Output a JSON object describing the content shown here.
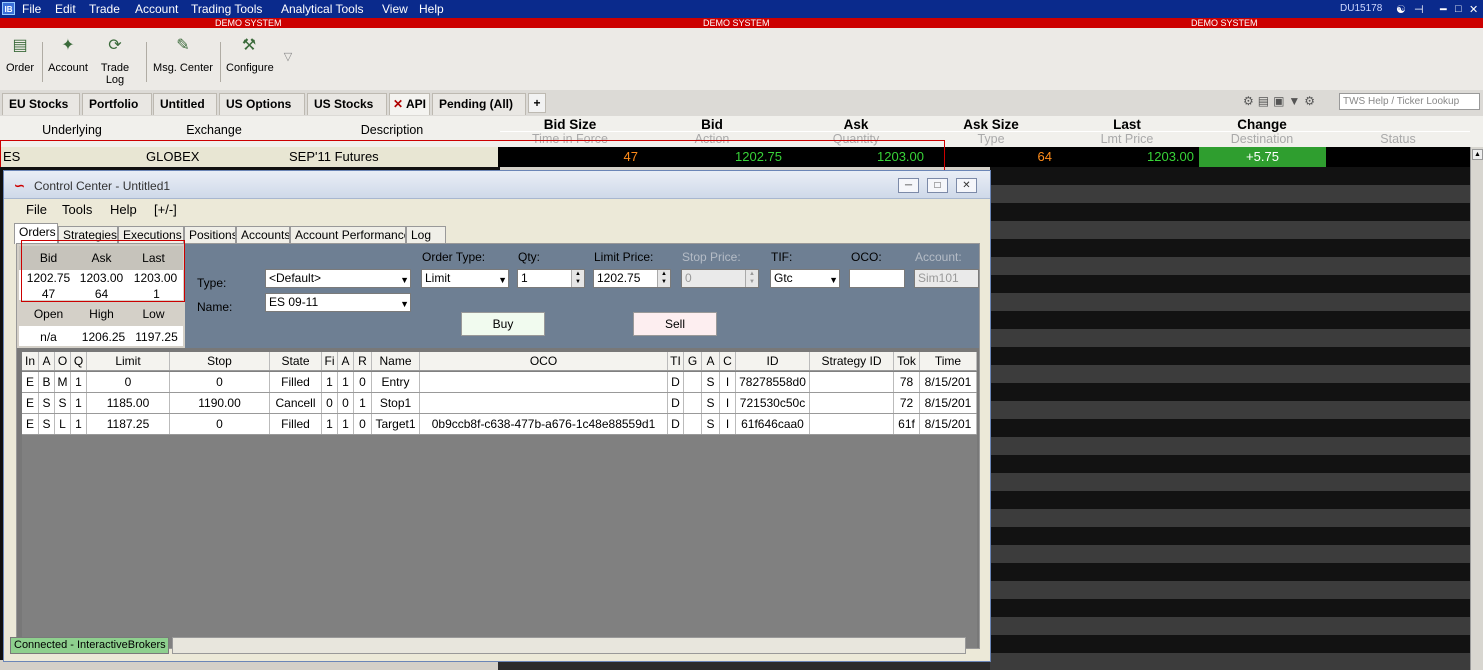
{
  "menubar": {
    "logo": "IB",
    "items": [
      "File",
      "Edit",
      "Trade",
      "Account",
      "Trading Tools",
      "Analytical Tools",
      "View",
      "Help"
    ],
    "account_id": "DU15178"
  },
  "demo_banner": [
    "DEMO SYSTEM",
    "DEMO SYSTEM",
    "DEMO SYSTEM"
  ],
  "toolbar": {
    "items": [
      "Order",
      "Account",
      "Trade Log",
      "Msg. Center",
      "Configure"
    ]
  },
  "tabs": {
    "items": [
      "EU Stocks",
      "Portfolio",
      "Untitled",
      "US Options",
      "US Stocks",
      "API",
      "Pending (All)"
    ],
    "active": "API",
    "add": "+",
    "search_placeholder": "TWS Help / Ticker Lookup"
  },
  "columns": {
    "left": [
      "Underlying",
      "Exchange",
      "Description"
    ],
    "top": [
      "Bid Size",
      "Bid",
      "Ask",
      "Ask Size",
      "Last",
      "Change"
    ],
    "sub": [
      "Time in Force",
      "Action",
      "Quantity",
      "Type",
      "Lmt Price",
      "Destination",
      "Status"
    ]
  },
  "row": {
    "underlying": "ES",
    "exchange": "GLOBEX",
    "description": "SEP'11 Futures",
    "bid_size": "47",
    "bid": "1202.75",
    "ask": "1203.00",
    "ask_size": "64",
    "last": "1203.00",
    "change": "+5.75"
  },
  "colors": {
    "bid_size": "#ff8c1a",
    "price": "#38d338",
    "change_bg": "#2f9e2f",
    "demo": "#cc0000",
    "menubar": "#0a2a8c"
  },
  "control_center": {
    "title": "Control Center - Untitled1",
    "menu": [
      "File",
      "Tools",
      "Help",
      "[+/-]"
    ],
    "tabs": [
      "Orders",
      "Strategies",
      "Executions",
      "Positions",
      "Accounts",
      "Account Performance",
      "Log"
    ],
    "active_tab": "Orders",
    "quote": {
      "headers": [
        "Bid",
        "Ask",
        "Last"
      ],
      "prices": [
        "1202.75",
        "1203.00",
        "1203.00"
      ],
      "sizes": [
        "47",
        "64",
        "1"
      ],
      "headers2": [
        "Open",
        "High",
        "Low"
      ],
      "values2": [
        "n/a",
        "1206.25",
        "1197.25"
      ]
    },
    "form": {
      "type_label": "Type:",
      "type_value": "<Default>",
      "name_label": "Name:",
      "name_value": "ES 09-11",
      "order_type_label": "Order Type:",
      "order_type_value": "Limit",
      "qty_label": "Qty:",
      "qty_value": "1",
      "limit_label": "Limit Price:",
      "limit_value": "1202.75",
      "stop_label": "Stop Price:",
      "stop_value": "0",
      "tif_label": "TIF:",
      "tif_value": "Gtc",
      "oco_label": "OCO:",
      "oco_value": "",
      "account_label": "Account:",
      "account_value": "Sim101",
      "buy": "Buy",
      "sell": "Sell"
    },
    "grid": {
      "headers": [
        "In",
        "A",
        "O",
        "Q",
        "Limit",
        "Stop",
        "State",
        "Fi",
        "A",
        "R",
        "Name",
        "OCO",
        "TI",
        "G",
        "A",
        "C",
        "ID",
        "Strategy ID",
        "Tok",
        "Time"
      ],
      "rows": [
        [
          "E",
          "B",
          "M",
          "1",
          "0",
          "0",
          "Filled",
          "1",
          "1",
          "0",
          "Entry",
          "",
          "D",
          "",
          "S",
          "I",
          "78278558d0",
          "",
          "78",
          "8/15/201"
        ],
        [
          "E",
          "S",
          "S",
          "1",
          "1185.00",
          "1190.00",
          "Cancell",
          "0",
          "0",
          "1",
          "Stop1",
          "",
          "D",
          "",
          "S",
          "I",
          "721530c50c",
          "",
          "72",
          "8/15/201"
        ],
        [
          "E",
          "S",
          "L",
          "1",
          "1187.25",
          "0",
          "Filled",
          "1",
          "1",
          "0",
          "Target1",
          "0b9ccb8f-c638-477b-a676-1c48e88559d1",
          "D",
          "",
          "S",
          "I",
          "61f646caa0",
          "",
          "61f",
          "8/15/201"
        ]
      ]
    },
    "status": "Connected - InteractiveBrokers"
  }
}
